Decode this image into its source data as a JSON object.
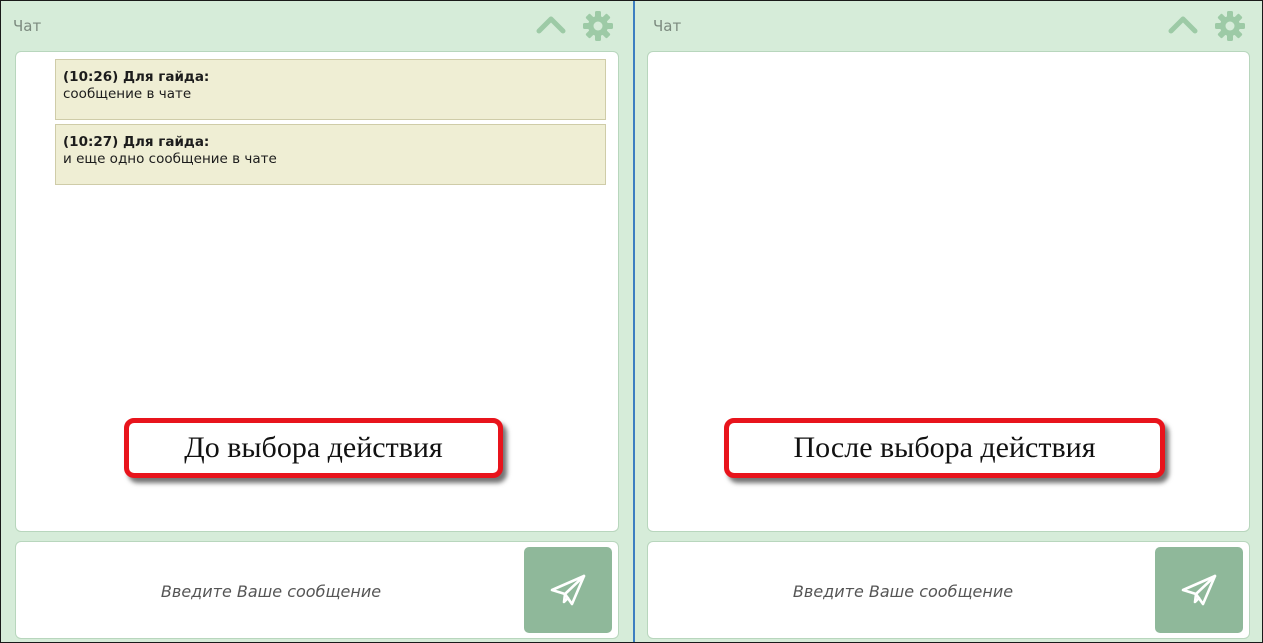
{
  "colors": {
    "panel_bg": "#d6ecd9",
    "message_bg": "#efeed4",
    "send_button": "#8fb89a",
    "icon": "#9dcaa6",
    "callout_border": "#e8141c",
    "divider": "#3d7fc1"
  },
  "left": {
    "title": "Чат",
    "collapse_icon": "chevron-up-icon",
    "settings_icon": "gear-icon",
    "messages": [
      {
        "header": "(10:26) Для гайда:",
        "text": "сообщение в чате"
      },
      {
        "header": "(10:27) Для гайда:",
        "text": "и еще одно сообщение в чате"
      }
    ],
    "callout": "До выбора действия",
    "input_placeholder": "Введите Ваше сообщение",
    "send_icon": "paper-plane-icon"
  },
  "right": {
    "title": "Чат",
    "collapse_icon": "chevron-up-icon",
    "settings_icon": "gear-icon",
    "messages": [],
    "callout": "После выбора действия",
    "input_placeholder": "Введите Ваше сообщение",
    "send_icon": "paper-plane-icon"
  }
}
